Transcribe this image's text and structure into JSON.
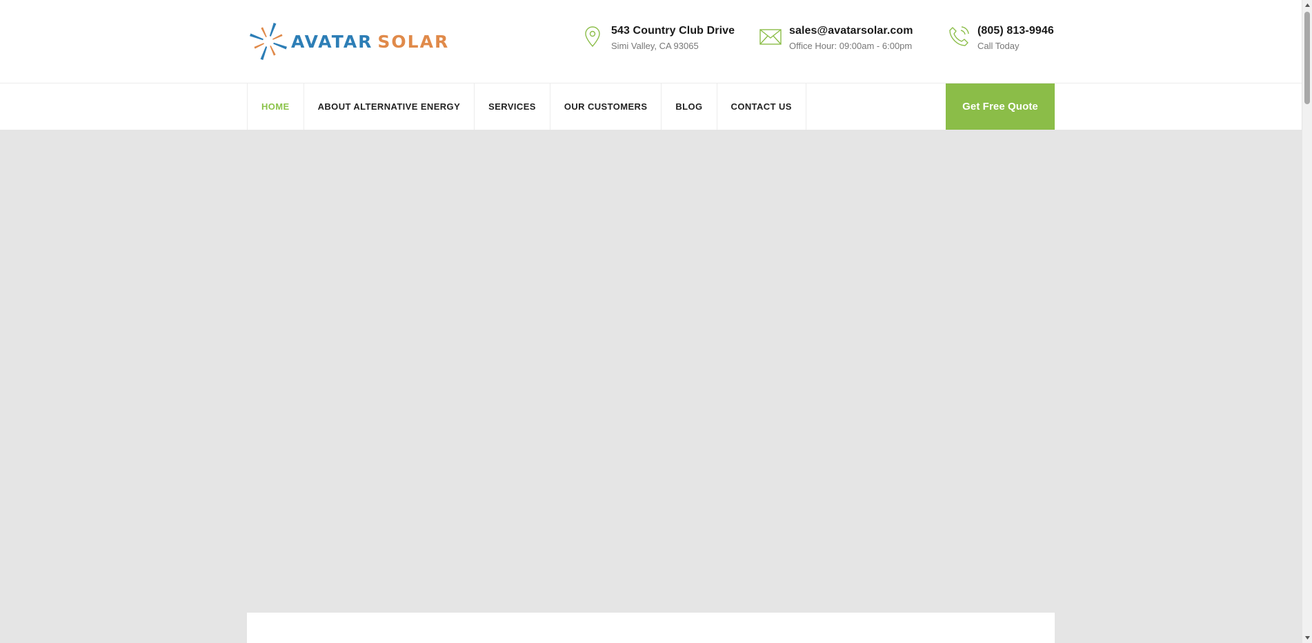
{
  "brand": {
    "logo_word_1": "AVATAR",
    "logo_word_2": "SOLAR",
    "colors": {
      "blue": "#2d7eb6",
      "orange": "#e08a4a",
      "green": "#8bbd48"
    }
  },
  "contact": {
    "address": {
      "icon": "map-pin-icon",
      "title": "543 Country Club Drive",
      "sub": "Simi Valley, CA 93065"
    },
    "email": {
      "icon": "envelope-icon",
      "title": "sales@avatarsolar.com",
      "sub": "Office Hour: 09:00am - 6:00pm"
    },
    "phone": {
      "icon": "phone-icon",
      "title": "(805) 813-9946",
      "sub": "Call Today"
    }
  },
  "nav": {
    "items": [
      {
        "label": "HOME",
        "active": true
      },
      {
        "label": "ABOUT ALTERNATIVE ENERGY"
      },
      {
        "label": "SERVICES"
      },
      {
        "label": "OUR CUSTOMERS"
      },
      {
        "label": "BLOG"
      },
      {
        "label": "CONTACT US"
      }
    ],
    "cta_label": "Get Free Quote"
  }
}
